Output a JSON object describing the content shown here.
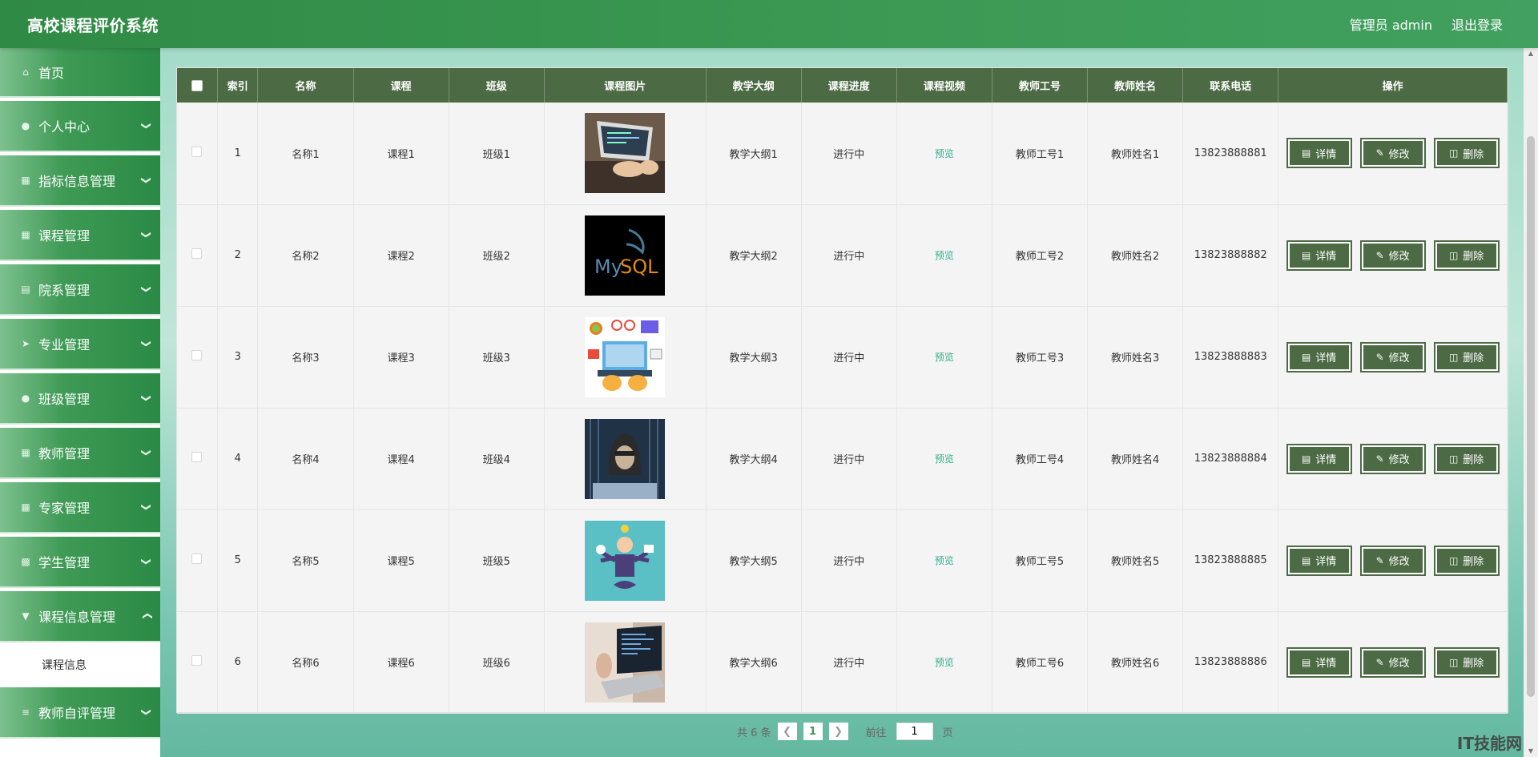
{
  "header": {
    "title": "高校课程评价系统",
    "user_label": "管理员 admin",
    "logout_label": "退出登录"
  },
  "sidebar": {
    "items": [
      {
        "label": "首页",
        "icon": "home-icon"
      },
      {
        "label": "个人中心",
        "icon": "user-icon"
      },
      {
        "label": "指标信息管理",
        "icon": "grid-icon"
      },
      {
        "label": "课程管理",
        "icon": "grid-icon"
      },
      {
        "label": "院系管理",
        "icon": "building-icon"
      },
      {
        "label": "专业管理",
        "icon": "send-icon"
      },
      {
        "label": "班级管理",
        "icon": "user-icon"
      },
      {
        "label": "教师管理",
        "icon": "grid-icon"
      },
      {
        "label": "专家管理",
        "icon": "grid-icon"
      },
      {
        "label": "学生管理",
        "icon": "clipboard-icon"
      },
      {
        "label": "课程信息管理",
        "icon": "marker-icon"
      },
      {
        "label": "教师自评管理",
        "icon": "sliders-icon"
      }
    ],
    "submenu": {
      "label": "课程信息"
    }
  },
  "table": {
    "columns": [
      "索引",
      "名称",
      "课程",
      "班级",
      "课程图片",
      "教学大纲",
      "课程进度",
      "课程视频",
      "教师工号",
      "教师姓名",
      "联系电话",
      "操作"
    ],
    "rows": [
      {
        "index": "1",
        "name": "名称1",
        "course": "课程1",
        "class": "班级1",
        "image": "laptop-typing",
        "syllabus": "教学大纲1",
        "progress": "进行中",
        "video": "预览",
        "teacher_id": "教师工号1",
        "teacher_name": "教师姓名1",
        "phone": "13823888881"
      },
      {
        "index": "2",
        "name": "名称2",
        "course": "课程2",
        "class": "班级2",
        "image": "mysql-logo",
        "syllabus": "教学大纲2",
        "progress": "进行中",
        "video": "预览",
        "teacher_id": "教师工号2",
        "teacher_name": "教师姓名2",
        "phone": "13823888882"
      },
      {
        "index": "3",
        "name": "名称3",
        "course": "课程3",
        "class": "班级3",
        "image": "laptop-illustration",
        "syllabus": "教学大纲3",
        "progress": "进行中",
        "video": "预览",
        "teacher_id": "教师工号3",
        "teacher_name": "教师姓名3",
        "phone": "13823888883"
      },
      {
        "index": "4",
        "name": "名称4",
        "course": "课程4",
        "class": "班级4",
        "image": "hooded-hacker",
        "syllabus": "教学大纲4",
        "progress": "进行中",
        "video": "预览",
        "teacher_id": "教师工号4",
        "teacher_name": "教师姓名4",
        "phone": "13823888884"
      },
      {
        "index": "5",
        "name": "名称5",
        "course": "课程5",
        "class": "班级5",
        "image": "multitask-illustration",
        "syllabus": "教学大纲5",
        "progress": "进行中",
        "video": "预览",
        "teacher_id": "教师工号5",
        "teacher_name": "教师姓名5",
        "phone": "13823888885"
      },
      {
        "index": "6",
        "name": "名称6",
        "course": "课程6",
        "class": "班级6",
        "image": "laptop-code",
        "syllabus": "教学大纲6",
        "progress": "进行中",
        "video": "预览",
        "teacher_id": "教师工号6",
        "teacher_name": "教师姓名6",
        "phone": "13823888886"
      }
    ],
    "actions": {
      "detail": "详情",
      "edit": "修改",
      "delete": "删除"
    }
  },
  "pagination": {
    "total": "共 6 条",
    "current_page": "1",
    "goto_prefix": "前往",
    "goto_value": "1",
    "goto_suffix": "页"
  },
  "watermark": "IT技能网",
  "colors": {
    "header": "#3c9a55",
    "table_header": "#4c6b44",
    "action_button": "#4c6b44",
    "preview_link": "#2db28b"
  }
}
